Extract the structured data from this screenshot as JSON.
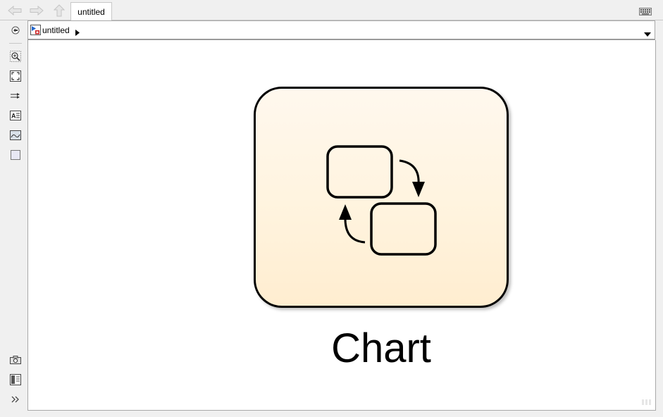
{
  "navigation": {
    "back_label": "Back",
    "forward_label": "Forward",
    "up_label": "Up to parent"
  },
  "tab": {
    "label": "untitled"
  },
  "address_bar": {
    "path_label": "untitled"
  },
  "left_toolbar": {
    "tools": [
      {
        "icon": "hide-explorer-icon"
      },
      {
        "icon": "zoom-icon"
      },
      {
        "icon": "fit-to-view-icon"
      },
      {
        "icon": "signal-lines-icon"
      },
      {
        "icon": "annotation-icon"
      },
      {
        "icon": "image-icon"
      },
      {
        "icon": "area-icon"
      },
      {
        "icon": "screenshot-icon"
      },
      {
        "icon": "property-inspector-icon"
      },
      {
        "icon": "expand-icon"
      }
    ]
  },
  "canvas": {
    "block": {
      "label": "Chart",
      "icon": "stateflow-chart-icon"
    }
  },
  "colors": {
    "block_fill_top": "#fff8ee",
    "block_fill_bottom": "#ffedd0",
    "block_border": "#000000"
  }
}
